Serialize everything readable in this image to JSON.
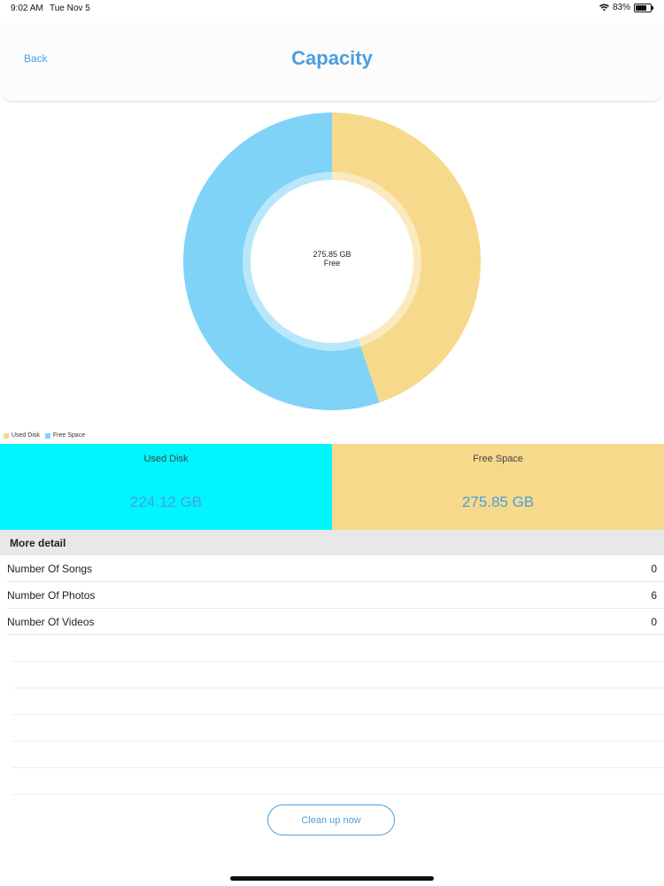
{
  "status_bar": {
    "time": "9:02 AM",
    "date": "Tue Nov 5",
    "battery": "83%",
    "battery_level": 0.83
  },
  "nav": {
    "back_label": "Back",
    "title": "Capacity"
  },
  "chart_data": {
    "type": "pie",
    "categories": [
      "Used Disk",
      "Free Space"
    ],
    "values": [
      224.12,
      275.85
    ],
    "colors": [
      "#f7d98c",
      "#7fd3f7"
    ],
    "center_value": "275.85 GB",
    "center_label": "Free",
    "legend": [
      "Used Disk",
      "Free Space"
    ],
    "legend_placement": "bottom-left"
  },
  "summary": [
    {
      "label": "Used Disk",
      "value": "224.12 GB",
      "color": "#00f5ff"
    },
    {
      "label": "Free Space",
      "value": "275.85 GB",
      "color": "#f7d98c"
    }
  ],
  "detail": {
    "title": "More detail",
    "rows": [
      {
        "label": "Number Of Songs",
        "value": "0"
      },
      {
        "label": "Number Of Photos",
        "value": "6"
      },
      {
        "label": "Number Of Videos",
        "value": "0"
      }
    ]
  },
  "cleanup_label": "Clean up now",
  "colors": {
    "accent": "#4a9fe0"
  }
}
